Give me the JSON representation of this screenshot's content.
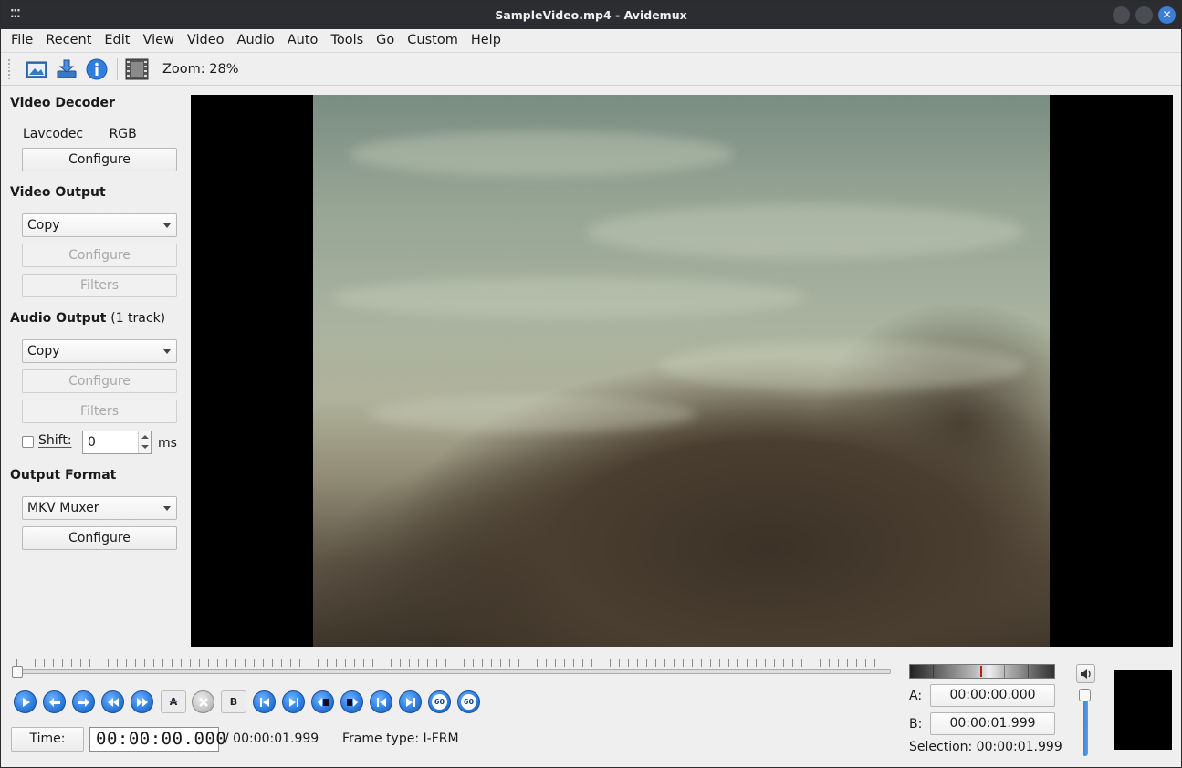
{
  "window": {
    "title": "SampleVideo.mp4 - Avidemux"
  },
  "menu": [
    "File",
    "Recent",
    "Edit",
    "View",
    "Video",
    "Audio",
    "Auto",
    "Tools",
    "Go",
    "Custom",
    "Help"
  ],
  "toolbar": {
    "zoom_label": "Zoom: 28%"
  },
  "video_decoder": {
    "title": "Video Decoder",
    "codec": "Lavcodec",
    "format": "RGB",
    "configure_label": "Configure"
  },
  "video_output": {
    "title": "Video Output",
    "selected": "Copy",
    "configure_label": "Configure",
    "filters_label": "Filters"
  },
  "audio_output": {
    "title": "Audio Output",
    "tracks": "(1 track)",
    "selected": "Copy",
    "configure_label": "Configure",
    "filters_label": "Filters",
    "shift_label": "Shift:",
    "shift_value": "0",
    "shift_unit": "ms"
  },
  "output_format": {
    "title": "Output Format",
    "selected": "MKV Muxer",
    "configure_label": "Configure"
  },
  "playback": {
    "time_button": "Time:",
    "current_time": "00:00:00.000",
    "duration": "/ 00:00:01.999",
    "frame_type": "Frame type:  I-FRM",
    "position_fraction": 0.0
  },
  "selection": {
    "a_label": "A:",
    "a_value": "00:00:00.000",
    "b_label": "B:",
    "b_value": "00:00:01.999",
    "selection_text": "Selection: 00:00:01.999"
  },
  "controls": {
    "marker_a": "A",
    "marker_b": "B",
    "jump_60": "60"
  },
  "colors": {
    "accent": "#2f7fe0",
    "titlebar": "#2b2d31"
  }
}
